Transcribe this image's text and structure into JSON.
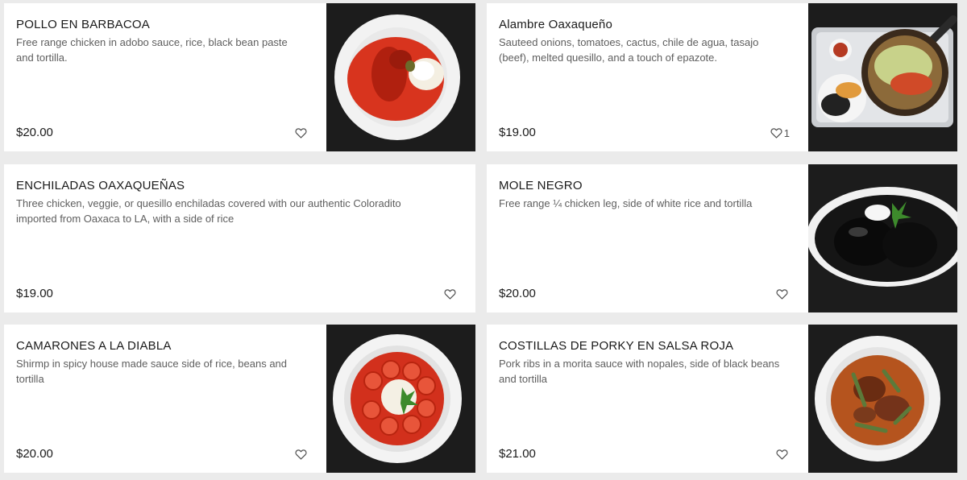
{
  "items": [
    {
      "name": "POLLO EN BARBACOA",
      "description": "Free range chicken in adobo sauce, rice, black bean paste and tortilla.",
      "price": "$20.00",
      "favorites": "",
      "photo": "red-sauce-chicken-plate"
    },
    {
      "name": "Alambre Oaxaqueño",
      "description": "Sauteed onions, tomatoes, cactus, chile de agua, tasajo (beef), melted quesillo, and a touch of epazote.",
      "price": "$19.00",
      "favorites": "1",
      "photo": "skillet-tray-plate"
    },
    {
      "name": "ENCHILADAS OAXAQUEÑAS",
      "description": "Three chicken, veggie, or quesillo enchiladas covered with our authentic Coloradito imported from Oaxaca to LA, with a side of rice",
      "price": "$19.00",
      "favorites": "",
      "photo": ""
    },
    {
      "name": "MOLE NEGRO",
      "description": "Free range ¼ chicken leg, side of white rice and tortilla",
      "price": "$20.00",
      "favorites": "",
      "photo": "black-mole-plate"
    },
    {
      "name": "CAMARONES A LA DIABLA",
      "description": "Shirmp in spicy house made sauce side of rice, beans and tortilla",
      "price": "$20.00",
      "favorites": "",
      "photo": "shrimp-diabla-plate"
    },
    {
      "name": "COSTILLAS DE PORKY EN SALSA ROJA",
      "description": "Pork ribs in a morita sauce with nopales, side of black beans and tortilla",
      "price": "$21.00",
      "favorites": "",
      "photo": "pork-ribs-red-sauce-plate"
    }
  ],
  "icons": {
    "favorite": "heart-outline-icon"
  },
  "colors": {
    "page_bg": "#ebebeb",
    "card_bg": "#ffffff",
    "photo_bg": "#1c1c1c"
  }
}
